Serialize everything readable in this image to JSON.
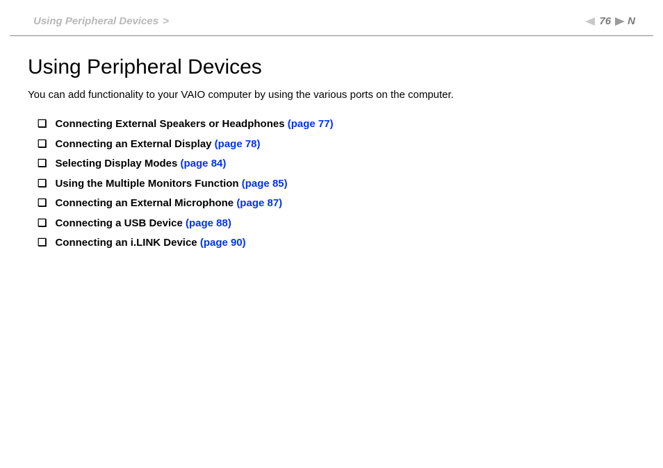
{
  "header": {
    "breadcrumb": "Using Peripheral Devices",
    "breadcrumb_sep": ">",
    "page_number": "76",
    "n_label": "N"
  },
  "content": {
    "title": "Using Peripheral Devices",
    "intro": "You can add functionality to your VAIO computer by using the various ports on the computer.",
    "items": [
      {
        "label": "Connecting External Speakers or Headphones ",
        "page": "(page 77)"
      },
      {
        "label": "Connecting an External Display ",
        "page": "(page 78)"
      },
      {
        "label": "Selecting Display Modes ",
        "page": "(page 84)"
      },
      {
        "label": "Using the Multiple Monitors Function ",
        "page": "(page 85)"
      },
      {
        "label": "Connecting an External Microphone ",
        "page": "(page 87)"
      },
      {
        "label": "Connecting a USB Device ",
        "page": "(page 88)"
      },
      {
        "label": "Connecting an i.LINK Device ",
        "page": "(page 90)"
      }
    ]
  },
  "bullet": "❑"
}
